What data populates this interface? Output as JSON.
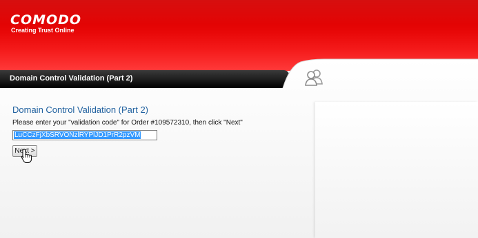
{
  "app": {
    "brand": "COMODO",
    "tagline": "Creating Trust Online"
  },
  "titlebar": {
    "title": "Domain Control Validation (Part 2)"
  },
  "main": {
    "heading": "Domain Control Validation (Part 2)",
    "prompt": "Please enter your \"validation code\" for Order #109572310, then click \"Next\"",
    "validation_code_value": "LuCCzFjXbSRVONzlRYPlJD1PrR2pzVM",
    "next_button_label": "Next >"
  },
  "icons": {
    "user": "users-icon",
    "cursor": "hand-pointer-icon"
  },
  "colors": {
    "brand_red": "#e30000",
    "title_bar": "#1a1a1a",
    "heading_blue": "#1e5f9e",
    "selection_blue": "#3399ff"
  }
}
